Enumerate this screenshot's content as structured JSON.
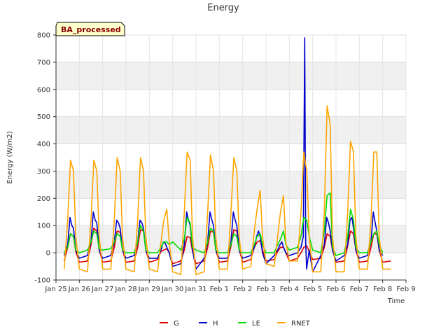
{
  "chart_data": {
    "type": "line",
    "title": "Energy",
    "badge": "BA_processed",
    "xlabel": "Time",
    "ylabel": "Energy (W/m2)",
    "ylim": [
      -100,
      800
    ],
    "yticks": [
      -100,
      0,
      100,
      200,
      300,
      400,
      500,
      600,
      700,
      800
    ],
    "xlim": [
      0,
      15
    ],
    "xticks": [
      {
        "x": 0,
        "label": "Jan 25"
      },
      {
        "x": 1,
        "label": "Jan 26"
      },
      {
        "x": 2,
        "label": "Jan 27"
      },
      {
        "x": 3,
        "label": "Jan 28"
      },
      {
        "x": 4,
        "label": "Jan 29"
      },
      {
        "x": 5,
        "label": "Jan 30"
      },
      {
        "x": 6,
        "label": "Jan 31"
      },
      {
        "x": 7,
        "label": "Feb 1"
      },
      {
        "x": 8,
        "label": "Feb 2"
      },
      {
        "x": 9,
        "label": "Feb 3"
      },
      {
        "x": 10,
        "label": "Feb 4"
      },
      {
        "x": 11,
        "label": "Feb 5"
      },
      {
        "x": 12,
        "label": "Feb 6"
      },
      {
        "x": 13,
        "label": "Feb 7"
      },
      {
        "x": 14,
        "label": "Feb 8"
      },
      {
        "x": 15,
        "label": "Feb 9"
      }
    ],
    "grid": true,
    "legend_position": "bottom",
    "series": [
      {
        "name": "G",
        "color": "#dd0000",
        "x": [
          0.35,
          0.5,
          0.62,
          0.75,
          0.85,
          1.0,
          1.35,
          1.5,
          1.62,
          1.75,
          1.85,
          2.0,
          2.35,
          2.5,
          2.62,
          2.75,
          2.85,
          3.0,
          3.35,
          3.5,
          3.62,
          3.75,
          3.85,
          4.0,
          4.35,
          4.5,
          4.62,
          4.75,
          4.85,
          5.0,
          5.35,
          5.5,
          5.62,
          5.75,
          5.85,
          6.0,
          6.35,
          6.5,
          6.62,
          6.75,
          6.85,
          7.0,
          7.35,
          7.5,
          7.62,
          7.75,
          7.85,
          8.0,
          8.35,
          8.5,
          8.62,
          8.75,
          8.85,
          9.0,
          9.35,
          9.5,
          9.62,
          9.75,
          9.85,
          10.0,
          10.35,
          10.5,
          10.62,
          10.75,
          10.85,
          11.0,
          11.35,
          11.5,
          11.62,
          11.75,
          11.85,
          12.0,
          12.35,
          12.5,
          12.62,
          12.75,
          12.85,
          13.0,
          13.35,
          13.5,
          13.62,
          13.75,
          13.85,
          14.0,
          14.35
        ],
        "y": [
          -30,
          20,
          70,
          60,
          5,
          -35,
          -30,
          30,
          90,
          80,
          10,
          -35,
          -30,
          20,
          80,
          75,
          10,
          -35,
          -30,
          20,
          85,
          80,
          10,
          -35,
          -25,
          5,
          10,
          15,
          0,
          -40,
          -30,
          10,
          60,
          55,
          5,
          -40,
          -30,
          20,
          80,
          75,
          10,
          -35,
          -30,
          25,
          85,
          80,
          10,
          -35,
          -25,
          20,
          40,
          45,
          10,
          -30,
          -25,
          5,
          20,
          20,
          0,
          -30,
          -20,
          0,
          20,
          25,
          5,
          -25,
          -20,
          20,
          70,
          60,
          10,
          -35,
          -30,
          25,
          80,
          70,
          10,
          -35,
          -30,
          20,
          70,
          70,
          10,
          -35,
          -30
        ]
      },
      {
        "name": "H",
        "color": "#0000cc",
        "x": [
          0.35,
          0.5,
          0.6,
          0.68,
          0.75,
          0.85,
          1.0,
          1.35,
          1.5,
          1.6,
          1.68,
          1.75,
          1.85,
          2.0,
          2.35,
          2.5,
          2.6,
          2.68,
          2.75,
          2.85,
          3.0,
          3.35,
          3.5,
          3.6,
          3.68,
          3.75,
          3.85,
          4.0,
          4.35,
          4.5,
          4.6,
          4.68,
          4.75,
          4.85,
          5.0,
          5.35,
          5.5,
          5.6,
          5.68,
          5.75,
          5.85,
          6.0,
          6.35,
          6.5,
          6.6,
          6.68,
          6.75,
          6.85,
          7.0,
          7.35,
          7.5,
          7.6,
          7.68,
          7.75,
          7.85,
          8.0,
          8.35,
          8.5,
          8.6,
          8.68,
          8.75,
          8.85,
          9.0,
          9.35,
          9.5,
          9.6,
          9.68,
          9.75,
          9.85,
          10.0,
          10.35,
          10.5,
          10.6,
          10.66,
          10.7,
          10.74,
          10.85,
          11.0,
          11.35,
          11.5,
          11.6,
          11.68,
          11.75,
          11.85,
          12.0,
          12.35,
          12.5,
          12.6,
          12.68,
          12.75,
          12.85,
          13.0,
          13.35,
          13.5,
          13.6,
          13.68,
          13.75,
          13.85,
          14.0
        ],
        "y": [
          -10,
          30,
          130,
          100,
          90,
          10,
          -20,
          -10,
          40,
          150,
          120,
          110,
          10,
          -20,
          -10,
          40,
          120,
          110,
          90,
          10,
          -20,
          -10,
          40,
          120,
          110,
          90,
          10,
          -20,
          -20,
          10,
          40,
          35,
          20,
          0,
          -50,
          -40,
          30,
          150,
          120,
          100,
          10,
          -60,
          -20,
          40,
          150,
          120,
          100,
          10,
          -20,
          -20,
          40,
          150,
          120,
          100,
          10,
          -20,
          -10,
          20,
          60,
          80,
          60,
          0,
          -40,
          -10,
          10,
          30,
          40,
          20,
          0,
          -10,
          0,
          20,
          60,
          790,
          40,
          -60,
          10,
          -70,
          -10,
          30,
          130,
          110,
          80,
          10,
          -30,
          -10,
          30,
          120,
          130,
          90,
          10,
          -20,
          -10,
          40,
          150,
          110,
          80,
          10,
          -10
        ]
      },
      {
        "name": "LE",
        "color": "#00dd00",
        "x": [
          0.35,
          0.5,
          0.62,
          0.75,
          0.85,
          1.0,
          1.35,
          1.5,
          1.62,
          1.75,
          1.85,
          2.0,
          2.35,
          2.5,
          2.62,
          2.75,
          2.85,
          3.0,
          3.35,
          3.5,
          3.62,
          3.75,
          3.85,
          4.0,
          4.35,
          4.5,
          4.62,
          4.75,
          4.85,
          5.0,
          5.35,
          5.5,
          5.62,
          5.75,
          5.85,
          6.0,
          6.35,
          6.5,
          6.62,
          6.75,
          6.85,
          7.0,
          7.35,
          7.5,
          7.62,
          7.75,
          7.85,
          8.0,
          8.35,
          8.5,
          8.62,
          8.75,
          8.85,
          9.0,
          9.35,
          9.5,
          9.62,
          9.75,
          9.85,
          10.0,
          10.35,
          10.5,
          10.62,
          10.75,
          10.85,
          11.0,
          11.35,
          11.5,
          11.62,
          11.75,
          11.85,
          12.0,
          12.35,
          12.5,
          12.62,
          12.75,
          12.85,
          13.0,
          13.35,
          13.5,
          13.62,
          13.75,
          13.85,
          14.0
        ],
        "y": [
          0,
          20,
          70,
          60,
          10,
          0,
          10,
          40,
          80,
          70,
          15,
          10,
          15,
          40,
          70,
          60,
          10,
          0,
          0,
          40,
          100,
          80,
          10,
          0,
          0,
          20,
          40,
          40,
          30,
          40,
          10,
          50,
          130,
          110,
          20,
          10,
          0,
          40,
          90,
          80,
          10,
          0,
          0,
          30,
          70,
          60,
          10,
          0,
          0,
          30,
          60,
          70,
          30,
          0,
          0,
          30,
          50,
          80,
          30,
          10,
          20,
          60,
          130,
          120,
          60,
          10,
          0,
          80,
          210,
          220,
          20,
          -10,
          0,
          60,
          160,
          120,
          20,
          0,
          0,
          40,
          70,
          80,
          30,
          0
        ]
      },
      {
        "name": "RNET",
        "color": "#ffa500",
        "x": [
          0.35,
          0.5,
          0.62,
          0.75,
          0.85,
          1.0,
          1.35,
          1.5,
          1.62,
          1.75,
          1.85,
          2.0,
          2.35,
          2.5,
          2.62,
          2.75,
          2.85,
          3.0,
          3.35,
          3.5,
          3.62,
          3.75,
          3.85,
          4.0,
          4.35,
          4.5,
          4.62,
          4.75,
          4.85,
          5.0,
          5.35,
          5.5,
          5.62,
          5.75,
          5.85,
          6.0,
          6.35,
          6.5,
          6.62,
          6.75,
          6.85,
          7.0,
          7.35,
          7.5,
          7.62,
          7.75,
          7.85,
          8.0,
          8.35,
          8.5,
          8.62,
          8.75,
          8.85,
          9.0,
          9.35,
          9.5,
          9.62,
          9.75,
          9.85,
          10.0,
          10.35,
          10.5,
          10.62,
          10.75,
          10.85,
          11.0,
          11.35,
          11.5,
          11.62,
          11.75,
          11.85,
          12.0,
          12.35,
          12.5,
          12.62,
          12.75,
          12.85,
          13.0,
          13.35,
          13.5,
          13.62,
          13.75,
          13.85,
          14.0,
          14.35
        ],
        "y": [
          -60,
          120,
          340,
          300,
          60,
          -60,
          -70,
          120,
          340,
          300,
          60,
          -60,
          -60,
          120,
          350,
          300,
          60,
          -60,
          -70,
          120,
          350,
          300,
          60,
          -60,
          -70,
          40,
          120,
          160,
          40,
          -70,
          -80,
          150,
          370,
          340,
          60,
          -80,
          -70,
          150,
          360,
          300,
          60,
          -60,
          -60,
          150,
          350,
          300,
          60,
          -60,
          -50,
          80,
          160,
          230,
          60,
          -40,
          -50,
          60,
          150,
          210,
          40,
          -30,
          -30,
          150,
          370,
          300,
          60,
          -70,
          -70,
          150,
          540,
          470,
          60,
          -70,
          -70,
          150,
          410,
          370,
          60,
          -60,
          -60,
          120,
          370,
          370,
          60,
          -60,
          -60
        ]
      }
    ]
  }
}
